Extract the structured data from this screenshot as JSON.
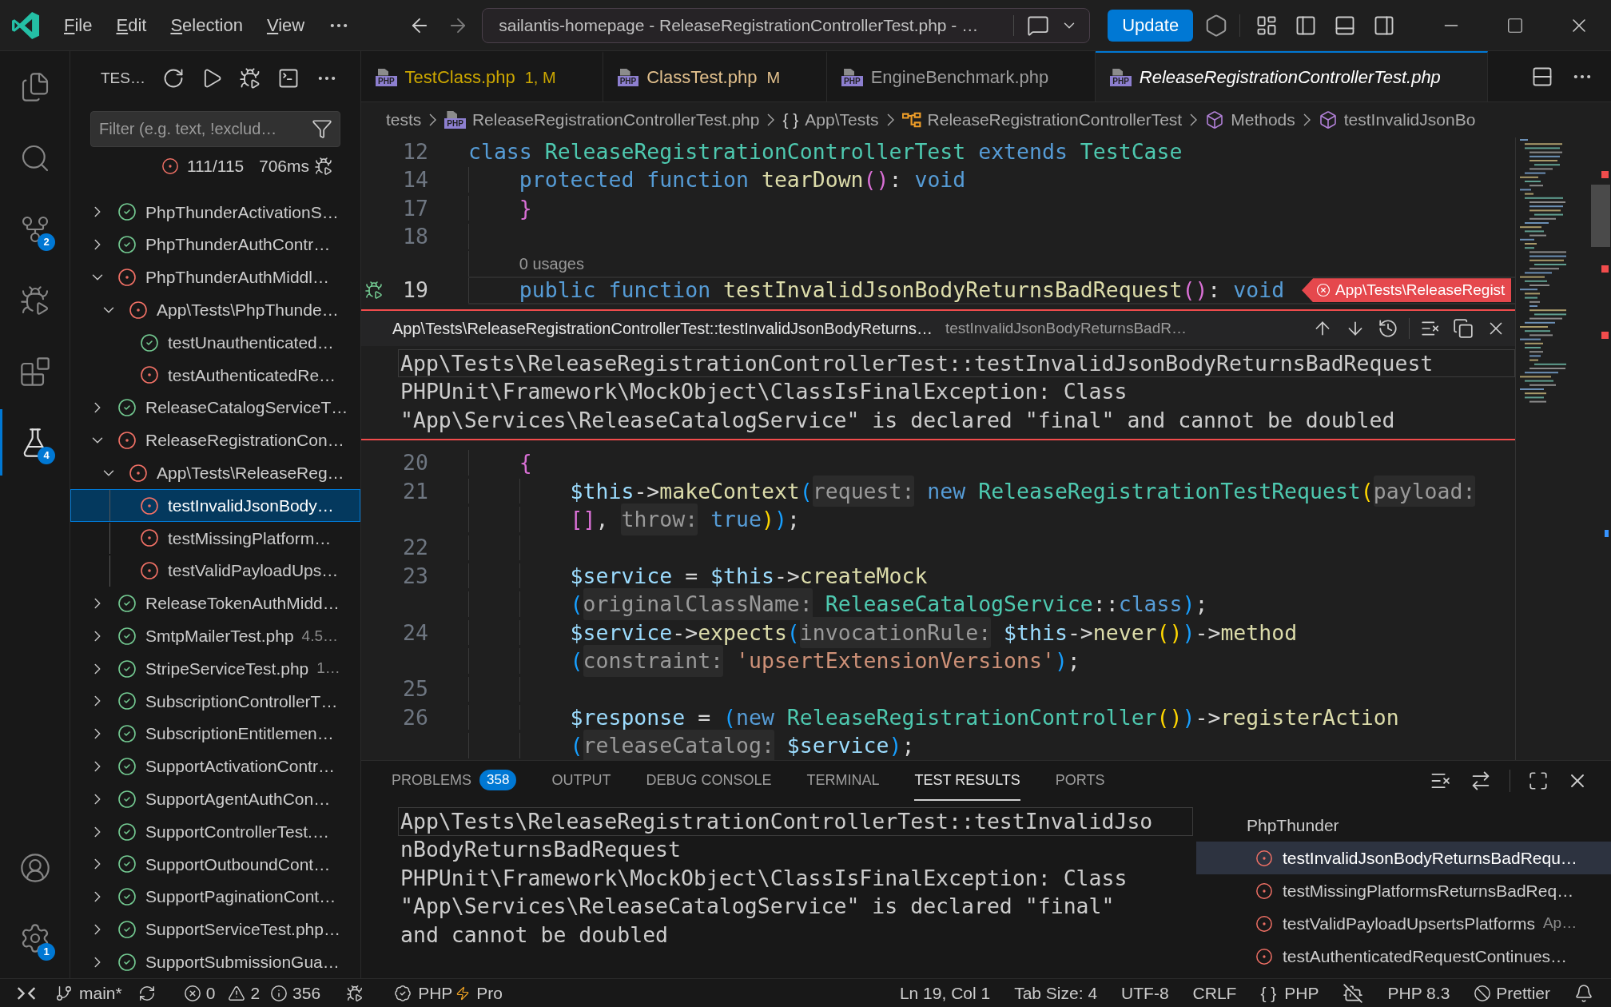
{
  "title_bar": {
    "menus": [
      "File",
      "Edit",
      "Selection",
      "View"
    ],
    "command_center": "sailantis-homepage - ReleaseRegistrationControllerTest.php - …",
    "update_button": "Update"
  },
  "activity_bar": {
    "items": [
      {
        "kind": "explorer",
        "selected": false
      },
      {
        "kind": "search",
        "selected": false
      },
      {
        "kind": "source_control",
        "badge": "2",
        "selected": false
      },
      {
        "kind": "run_debug",
        "selected": false
      },
      {
        "kind": "extensions",
        "selected": false
      },
      {
        "kind": "testing",
        "badge": "4",
        "selected": true
      }
    ],
    "bottom": [
      {
        "kind": "accounts"
      },
      {
        "kind": "settings",
        "badge": "1"
      }
    ]
  },
  "sidebar": {
    "title": "TES…",
    "filter": {
      "placeholder": "Filter (e.g. text, !exclud…"
    },
    "summary": {
      "failed": true,
      "count": "111/115",
      "duration": "706ms"
    },
    "tree": [
      {
        "label": "PhpThunderActivationS…",
        "failed": false,
        "expanded": false,
        "selected": false
      },
      {
        "label": "PhpThunderAuthContr…",
        "failed": false,
        "expanded": false,
        "selected": false
      },
      {
        "label": "PhpThunderAuthMiddl…",
        "failed": true,
        "expanded": true,
        "selected": false,
        "children": [
          {
            "label": "App\\Tests\\PhpThunde…",
            "failed": true,
            "expanded": true,
            "selected": false,
            "children": [
              {
                "label": "testUnauthenticated…",
                "failed": false,
                "selected": false
              },
              {
                "label": "testAuthenticatedRe…",
                "failed": true,
                "selected": false
              }
            ]
          }
        ]
      },
      {
        "label": "ReleaseCatalogServiceT…",
        "failed": false,
        "expanded": false,
        "selected": false
      },
      {
        "label": "ReleaseRegistrationCon…",
        "failed": true,
        "expanded": true,
        "selected": false,
        "children": [
          {
            "label": "App\\Tests\\ReleaseReg…",
            "failed": true,
            "expanded": true,
            "selected": false,
            "children": [
              {
                "label": "testInvalidJsonBody…",
                "failed": true,
                "selected": true
              },
              {
                "label": "testMissingPlatform…",
                "failed": true,
                "selected": false
              },
              {
                "label": "testValidPayloadUps…",
                "failed": true,
                "selected": false
              }
            ]
          }
        ]
      },
      {
        "label": "ReleaseTokenAuthMidd…",
        "failed": false,
        "expanded": false,
        "selected": false
      },
      {
        "label": "SmtpMailerTest.php",
        "description": "4.5…",
        "failed": false,
        "expanded": false,
        "selected": false
      },
      {
        "label": "StripeServiceTest.php",
        "description": "1…",
        "failed": false,
        "expanded": false,
        "selected": false
      },
      {
        "label": "SubscriptionControllerT…",
        "failed": false,
        "expanded": false,
        "selected": false
      },
      {
        "label": "SubscriptionEntitlemen…",
        "failed": false,
        "expanded": false,
        "selected": false
      },
      {
        "label": "SupportActivationContr…",
        "failed": false,
        "expanded": false,
        "selected": false
      },
      {
        "label": "SupportAgentAuthCon…",
        "failed": false,
        "expanded": false,
        "selected": false
      },
      {
        "label": "SupportControllerTest.…",
        "failed": false,
        "expanded": false,
        "selected": false
      },
      {
        "label": "SupportOutboundCont…",
        "failed": false,
        "expanded": false,
        "selected": false
      },
      {
        "label": "SupportPaginationCont…",
        "failed": false,
        "expanded": false,
        "selected": false
      },
      {
        "label": "SupportServiceTest.php…",
        "failed": false,
        "expanded": false,
        "selected": false
      },
      {
        "label": "SupportSubmissionGua…",
        "failed": false,
        "expanded": false,
        "selected": false
      }
    ]
  },
  "tabs": [
    {
      "label": "TestClass.php",
      "badge": "1, M",
      "color": "#cca700",
      "icon_text": "PHP",
      "selected": false,
      "preview": false
    },
    {
      "label": "ClassTest.php",
      "badge": "M",
      "color": "#e2c08d",
      "icon_text": "PHP",
      "selected": false,
      "preview": false
    },
    {
      "label": "EngineBenchmark.php",
      "icon_text": "PHP",
      "selected": false,
      "preview": false
    },
    {
      "label": "ReleaseRegistrationControllerTest.php",
      "icon_text": "PHP",
      "selected": true,
      "preview": true
    }
  ],
  "breadcrumbs": [
    {
      "kind": "folder",
      "label": "tests"
    },
    {
      "kind": "file",
      "icon_text": "PHP",
      "label": "ReleaseRegistrationControllerTest.php"
    },
    {
      "kind": "namespace",
      "symbol": "{ }",
      "label": "App\\Tests"
    },
    {
      "kind": "class",
      "label": "ReleaseRegistrationControllerTest"
    },
    {
      "kind": "method",
      "label": "Methods"
    },
    {
      "kind": "method",
      "label": "testInvalidJsonBo"
    }
  ],
  "editor": {
    "lines": [
      {
        "kind": "code",
        "number": "12",
        "active": false,
        "tokens": [
          {
            "kind": "keyword",
            "text": "class "
          },
          {
            "kind": "type",
            "text": "ReleaseRegistrationControllerTest "
          },
          {
            "kind": "keyword",
            "text": "extends "
          },
          {
            "kind": "type",
            "text": "TestCase"
          }
        ],
        "children": [
          {
            "kind": "code",
            "number": "14",
            "active": false,
            "tokens": [
              {
                "kind": "keyword",
                "text": "protected function "
              },
              {
                "kind": "function",
                "text": "tearDown"
              },
              {
                "kind": "bracket1",
                "text": "()"
              },
              {
                "kind": "plain",
                "text": ": "
              },
              {
                "kind": "keyword",
                "text": "void"
              }
            ]
          },
          {
            "kind": "code",
            "number": "17",
            "active": false,
            "tokens": [
              {
                "kind": "bracket1",
                "text": "}"
              }
            ]
          },
          {
            "kind": "code",
            "number": "18",
            "active": false
          },
          {
            "kind": "codelens",
            "text": "0 usages"
          },
          {
            "kind": "test",
            "number": "19",
            "active": true,
            "tokens": [
              {
                "kind": "keyword",
                "text": "public function "
              },
              {
                "kind": "function",
                "text": "testInvalidJsonBodyReturnsBadRequest"
              },
              {
                "kind": "bracket1",
                "text": "()"
              },
              {
                "kind": "plain",
                "text": ": "
              },
              {
                "kind": "keyword",
                "text": "void"
              }
            ],
            "message": "App\\Tests\\ReleaseRegist"
          },
          {
            "kind": "peek",
            "title": "App\\Tests\\ReleaseRegistrationControllerTest::testInvalidJsonBodyReturns…",
            "subtitle": "testInvalidJsonBodyReturnsBadR…",
            "lines": [
              {
                "text": "App\\Tests\\ReleaseRegistrationControllerTest::testInvalidJsonBodyReturnsBadRequest",
                "focused": true
              },
              {
                "text": "PHPUnit\\Framework\\MockObject\\ClassIsFinalException: Class",
                "focused": false
              },
              {
                "text": "\"App\\Services\\ReleaseCatalogService\" is declared \"final\" and cannot be doubled",
                "focused": false
              }
            ]
          },
          {
            "kind": "code",
            "number": "20",
            "active": false,
            "tokens": [
              {
                "kind": "bracket1",
                "text": "{"
              }
            ],
            "children": [
              {
                "kind": "code",
                "number": "21",
                "active": false,
                "tokens": [
                  {
                    "kind": "variable",
                    "text": "$this"
                  },
                  {
                    "kind": "plain",
                    "text": "->"
                  },
                  {
                    "kind": "function",
                    "text": "makeContext"
                  },
                  {
                    "kind": "bracket3",
                    "text": "("
                  },
                  {
                    "kind": "hint",
                    "text": "request:"
                  },
                  {
                    "kind": "keyword",
                    "text": " new "
                  },
                  {
                    "kind": "type",
                    "text": "ReleaseRegistrationTestRequest"
                  },
                  {
                    "kind": "bracket2",
                    "text": "("
                  },
                  {
                    "kind": "hint",
                    "text": "payload:"
                  }
                ]
              },
              {
                "kind": "code",
                "active": false,
                "tokens": [
                  {
                    "kind": "bracket1",
                    "text": "[]"
                  },
                  {
                    "kind": "plain",
                    "text": ", "
                  },
                  {
                    "kind": "hint",
                    "text": "throw:"
                  },
                  {
                    "kind": "keyword",
                    "text": " true"
                  },
                  {
                    "kind": "bracket2",
                    "text": ")"
                  },
                  {
                    "kind": "bracket3",
                    "text": ")"
                  },
                  {
                    "kind": "plain",
                    "text": ";"
                  }
                ]
              },
              {
                "kind": "code",
                "number": "22",
                "active": false
              },
              {
                "kind": "code",
                "number": "23",
                "active": false,
                "tokens": [
                  {
                    "kind": "variable",
                    "text": "$service"
                  },
                  {
                    "kind": "plain",
                    "text": " = "
                  },
                  {
                    "kind": "variable",
                    "text": "$this"
                  },
                  {
                    "kind": "plain",
                    "text": "->"
                  },
                  {
                    "kind": "function",
                    "text": "createMock"
                  }
                ]
              },
              {
                "kind": "code",
                "active": false,
                "tokens": [
                  {
                    "kind": "bracket3",
                    "text": "("
                  },
                  {
                    "kind": "hint",
                    "text": "originalClassName:"
                  },
                  {
                    "kind": "type",
                    "text": " ReleaseCatalogService"
                  },
                  {
                    "kind": "plain",
                    "text": "::"
                  },
                  {
                    "kind": "keyword",
                    "text": "class"
                  },
                  {
                    "kind": "bracket3",
                    "text": ")"
                  },
                  {
                    "kind": "plain",
                    "text": ";"
                  }
                ]
              },
              {
                "kind": "code",
                "number": "24",
                "active": false,
                "tokens": [
                  {
                    "kind": "variable",
                    "text": "$service"
                  },
                  {
                    "kind": "plain",
                    "text": "->"
                  },
                  {
                    "kind": "function",
                    "text": "expects"
                  },
                  {
                    "kind": "bracket3",
                    "text": "("
                  },
                  {
                    "kind": "hint",
                    "text": "invocationRule:"
                  },
                  {
                    "kind": "variable",
                    "text": " $this"
                  },
                  {
                    "kind": "plain",
                    "text": "->"
                  },
                  {
                    "kind": "function",
                    "text": "never"
                  },
                  {
                    "kind": "bracket2",
                    "text": "()"
                  },
                  {
                    "kind": "bracket3",
                    "text": ")"
                  },
                  {
                    "kind": "plain",
                    "text": "->"
                  },
                  {
                    "kind": "function",
                    "text": "method"
                  }
                ]
              },
              {
                "kind": "code",
                "active": false,
                "tokens": [
                  {
                    "kind": "bracket3",
                    "text": "("
                  },
                  {
                    "kind": "hint",
                    "text": "constraint:"
                  },
                  {
                    "kind": "string",
                    "text": " 'upsertExtensionVersions'"
                  },
                  {
                    "kind": "bracket3",
                    "text": ")"
                  },
                  {
                    "kind": "plain",
                    "text": ";"
                  }
                ]
              },
              {
                "kind": "code",
                "number": "25",
                "active": false
              },
              {
                "kind": "code",
                "number": "26",
                "active": false,
                "tokens": [
                  {
                    "kind": "variable",
                    "text": "$response"
                  },
                  {
                    "kind": "plain",
                    "text": " = "
                  },
                  {
                    "kind": "bracket3",
                    "text": "("
                  },
                  {
                    "kind": "keyword",
                    "text": "new "
                  },
                  {
                    "kind": "type",
                    "text": "ReleaseRegistrationController"
                  },
                  {
                    "kind": "bracket2",
                    "text": "()"
                  },
                  {
                    "kind": "bracket3",
                    "text": ")"
                  },
                  {
                    "kind": "plain",
                    "text": "->"
                  },
                  {
                    "kind": "function",
                    "text": "registerAction"
                  }
                ]
              },
              {
                "kind": "code",
                "active": false,
                "tokens": [
                  {
                    "kind": "bracket3",
                    "text": "("
                  },
                  {
                    "kind": "hint",
                    "text": "releaseCatalog:"
                  },
                  {
                    "kind": "variable",
                    "text": " $service"
                  },
                  {
                    "kind": "bracket3",
                    "text": ")"
                  },
                  {
                    "kind": "plain",
                    "text": ";"
                  }
                ]
              }
            ]
          }
        ]
      }
    ]
  },
  "panel": {
    "tabs": [
      {
        "label": "PROBLEMS",
        "badge": "358",
        "selected": false
      },
      {
        "label": "OUTPUT",
        "selected": false
      },
      {
        "label": "DEBUG CONSOLE",
        "selected": false
      },
      {
        "label": "TERMINAL",
        "selected": false
      },
      {
        "label": "TEST RESULTS",
        "selected": true
      },
      {
        "label": "PORTS",
        "selected": false
      }
    ],
    "output": [
      {
        "text": "App\\Tests\\ReleaseRegistrationControllerTest::testInvalidJso",
        "focused": true
      },
      {
        "text": "nBodyReturnsBadRequest",
        "focused": false
      },
      {
        "text": "PHPUnit\\Framework\\MockObject\\ClassIsFinalException: Class",
        "focused": false
      },
      {
        "text": "\"App\\Services\\ReleaseCatalogService\" is declared \"final\"",
        "focused": false
      },
      {
        "text": "and cannot be doubled",
        "focused": false
      }
    ],
    "results": {
      "heading": "PhpThunder",
      "items": [
        {
          "label": "testInvalidJsonBodyReturnsBadRequ…",
          "failed": true,
          "selected": true
        },
        {
          "label": "testMissingPlatformsReturnsBadReq…",
          "failed": true,
          "selected": false
        },
        {
          "label": "testValidPayloadUpsertsPlatforms",
          "description": "Ap…",
          "failed": true,
          "selected": false
        },
        {
          "label": "testAuthenticatedRequestContinues…",
          "failed": true,
          "selected": false
        }
      ]
    }
  },
  "status_bar": {
    "branch": "main*",
    "errors": "0",
    "warnings": "2",
    "infos": "356",
    "extension": {
      "label": "PHP",
      "tier": "Pro"
    },
    "right": [
      {
        "kind": "text",
        "label": "Ln 19, Col 1"
      },
      {
        "kind": "text",
        "label": "Tab Size: 4"
      },
      {
        "kind": "text",
        "label": "UTF-8"
      },
      {
        "kind": "text",
        "label": "CRLF"
      },
      {
        "kind": "language",
        "symbol": "{ }",
        "label": "PHP"
      },
      {
        "kind": "assistant"
      },
      {
        "kind": "text",
        "label": "PHP 8.3"
      },
      {
        "kind": "formatter",
        "label": "Prettier"
      },
      {
        "kind": "notifications"
      }
    ]
  }
}
